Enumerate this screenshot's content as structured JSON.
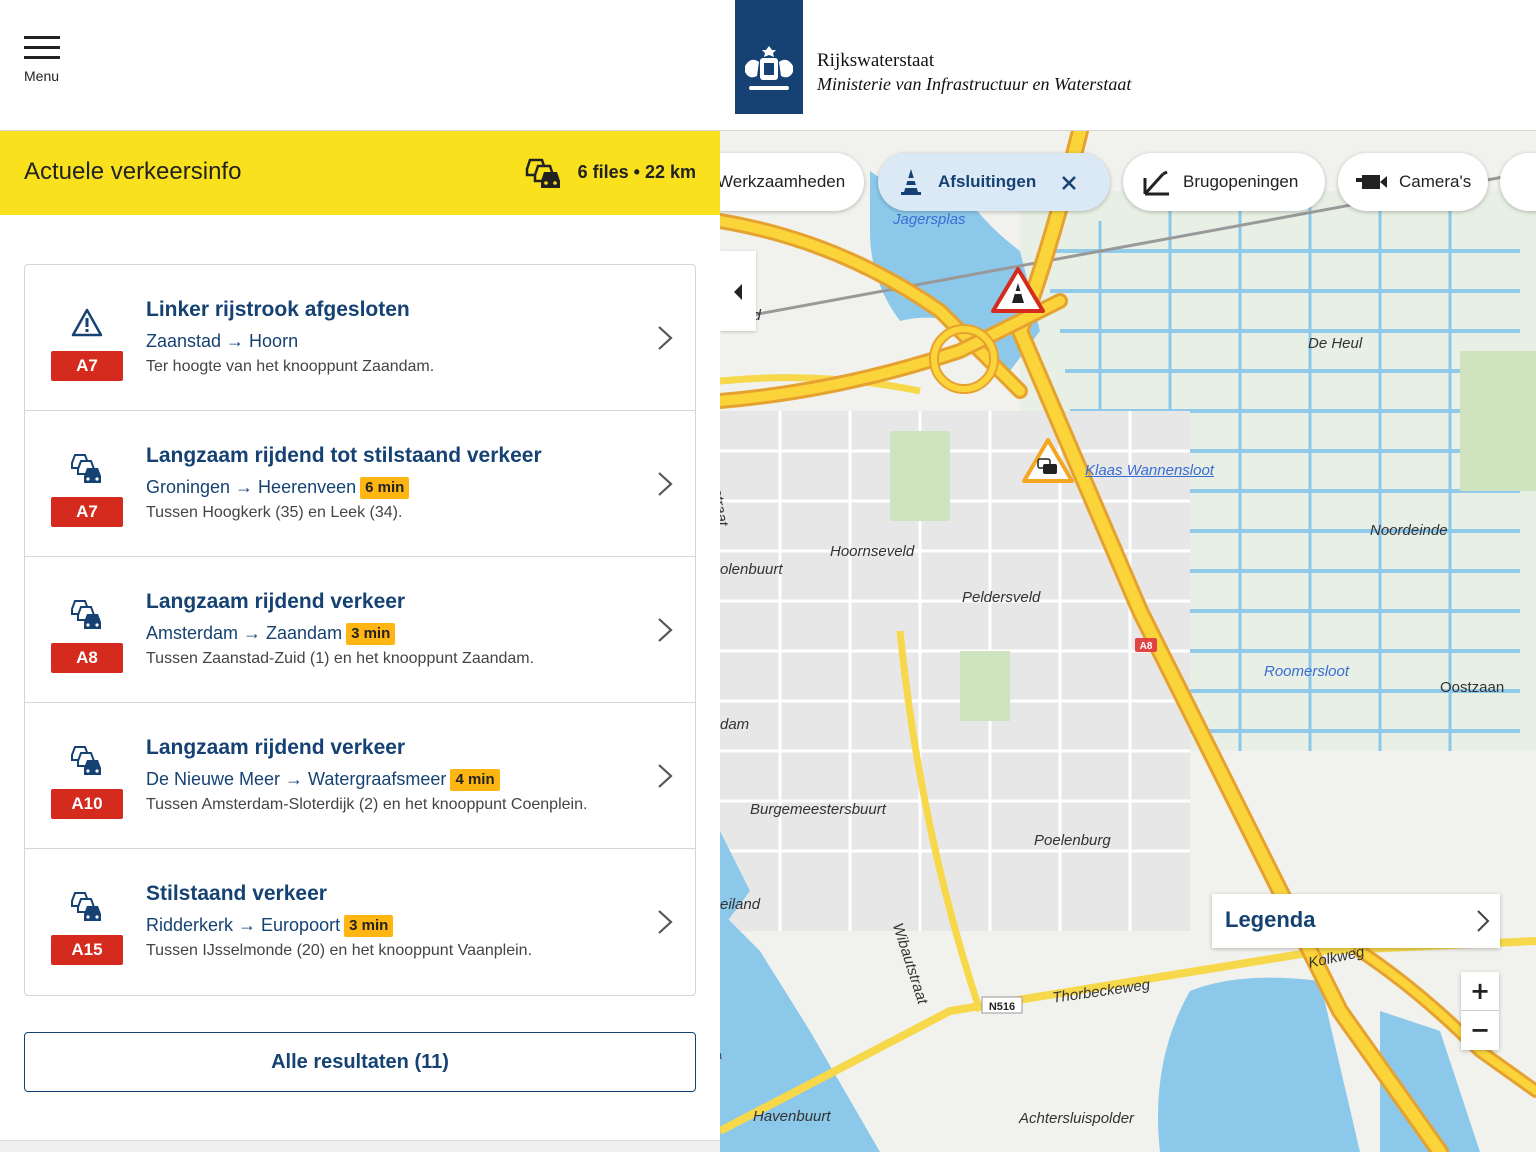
{
  "header": {
    "menu_label": "Menu",
    "org_name": "Rijkswaterstaat",
    "ministry": "Ministerie van Infrastructuur en Waterstaat"
  },
  "summary": {
    "title": "Actuele verkeersinfo",
    "count": "6 files • 22 km"
  },
  "incidents": [
    {
      "icon": "warning-icon",
      "road": "A7",
      "title": "Linker rijstrook afgesloten",
      "route": "Zaanstad → Hoorn",
      "delay": "",
      "desc": "Ter hoogte van het knooppunt Zaandam."
    },
    {
      "icon": "traffic-jam-icon",
      "road": "A7",
      "title": "Langzaam rijdend tot stilstaand verkeer",
      "route": "Groningen → Heerenveen",
      "delay": "6 min",
      "desc": "Tussen Hoogkerk (35) en Leek (34)."
    },
    {
      "icon": "traffic-jam-icon",
      "road": "A8",
      "title": "Langzaam rijdend verkeer",
      "route": "Amsterdam → Zaandam",
      "delay": "3 min",
      "desc": "Tussen Zaanstad-Zuid (1) en het knooppunt Zaandam."
    },
    {
      "icon": "traffic-jam-icon",
      "road": "A10",
      "title": "Langzaam rijdend verkeer",
      "route": "De Nieuwe Meer → Watergraafsmeer",
      "delay": "4 min",
      "desc": "Tussen Amsterdam-Sloterdijk (2) en het knooppunt Coenplein."
    },
    {
      "icon": "traffic-jam-icon",
      "road": "A15",
      "title": "Stilstaand verkeer",
      "route": "Ridderkerk → Europoort",
      "delay": "3 min",
      "desc": "Tussen IJsselmonde (20) en het knooppunt Vaanplein."
    }
  ],
  "all_results_label": "Alle resultaten (11)",
  "map": {
    "filters": [
      {
        "label": "Werkzaamheden",
        "active": false
      },
      {
        "label": "Afsluitingen",
        "active": true
      },
      {
        "label": "Brugopeningen",
        "active": false
      },
      {
        "label": "Camera's",
        "active": false
      }
    ],
    "legend_label": "Legenda",
    "zoom_in": "+",
    "zoom_out": "−",
    "road_shield": "A8",
    "route_label": "N516",
    "places": {
      "jagersplas": "Jagersplas",
      "de_heul": "De Heul",
      "klaas": "Klaas Wannensloot",
      "noordeinde": "Noordeinde",
      "hoornseveld": "Hoornseveld",
      "peldersveld": "Peldersveld",
      "olenbuurt": "olenbuurt",
      "roomersloot": "Roomersloot",
      "oostzaan": "Oostzaan",
      "dam": "dam",
      "burgemeestersbuurt": "Burgemeestersbuurt",
      "poelenburg": "Poelenburg",
      "eiland": "eiland",
      "wibautstraat": "Wibautstraat",
      "kolkweg": "Kolkweg",
      "thorbeckeweg": "Thorbeckeweg",
      "havenbuurt": "Havenbuurt",
      "achtersluispolder": "Achtersluispolder",
      "zaanstraat": "anstraat",
      "veld": "erveld",
      "weg": "weg"
    }
  }
}
